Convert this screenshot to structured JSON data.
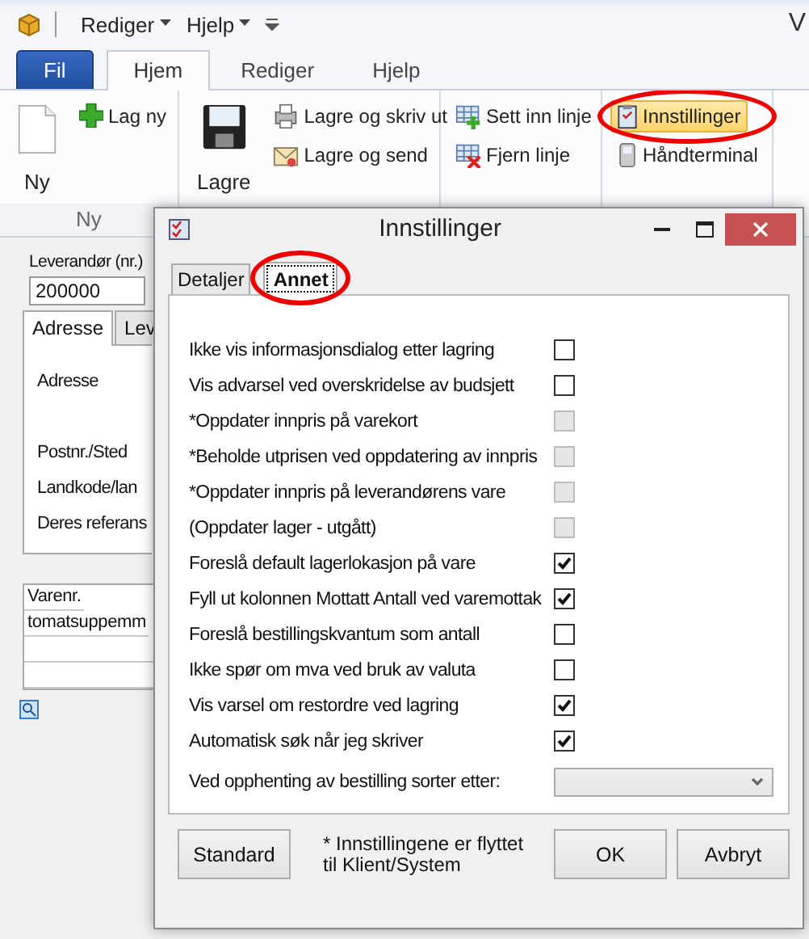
{
  "app": {
    "title_fragment": "V",
    "quick_menu": [
      {
        "label": "Rediger"
      },
      {
        "label": "Hjelp"
      }
    ]
  },
  "ribbon": {
    "tabs": [
      {
        "label": "Fil",
        "kind": "file",
        "selected": false
      },
      {
        "label": "Hjem",
        "kind": "tab",
        "selected": true
      },
      {
        "label": "Rediger",
        "kind": "tab",
        "selected": false
      },
      {
        "label": "Hjelp",
        "kind": "tab",
        "selected": false
      }
    ],
    "groups": [
      {
        "label": "Ny",
        "large": [
          {
            "label": "Ny"
          }
        ],
        "small": [
          {
            "label": "Lag ny",
            "active": false,
            "highlighted": false
          }
        ]
      },
      {
        "large": [
          {
            "label": "Lagre"
          }
        ],
        "small": [
          {
            "label": "Lagre og skriv ut",
            "active": false,
            "highlighted": false
          },
          {
            "label": "Lagre og send",
            "active": false,
            "highlighted": false
          }
        ]
      },
      {
        "small": [
          {
            "label": "Sett inn linje",
            "active": false,
            "highlighted": false
          },
          {
            "label": "Fjern linje",
            "active": false,
            "highlighted": false
          }
        ]
      },
      {
        "small": [
          {
            "label": "Innstillinger",
            "active": true,
            "highlighted": true
          },
          {
            "label": "Håndterminal",
            "active": false,
            "highlighted": false
          }
        ]
      }
    ]
  },
  "form": {
    "supplier_label": "Leverandør (nr.)",
    "supplier_value": "200000",
    "tabs": [
      {
        "label": "Adresse",
        "selected": true
      },
      {
        "label": "Lev",
        "selected": false
      }
    ],
    "fields": [
      {
        "label": "Adresse",
        "kind": "multiline"
      },
      {
        "label": "Postnr./Sted",
        "kind": "single"
      },
      {
        "label": "Landkode/lan",
        "kind": "single"
      },
      {
        "label": "Deres referans",
        "kind": "single"
      }
    ],
    "grid": {
      "columns": [
        "Varenr."
      ],
      "rows": [
        [
          "tomatsuppemm"
        ]
      ]
    }
  },
  "dialog": {
    "title": "Innstillinger",
    "tabs": [
      {
        "label": "Detaljer",
        "selected": false,
        "highlighted": false
      },
      {
        "label": "Annet",
        "selected": true,
        "highlighted": true
      }
    ],
    "options": [
      {
        "kind": "checkbox",
        "label": "Ikke vis informasjonsdialog etter lagring",
        "checked": false,
        "disabled": false
      },
      {
        "kind": "checkbox",
        "label": "Vis advarsel ved overskridelse av budsjett",
        "checked": false,
        "disabled": false
      },
      {
        "kind": "checkbox",
        "label": "*Oppdater innpris på varekort",
        "checked": false,
        "disabled": true
      },
      {
        "kind": "checkbox",
        "label": "*Beholde utprisen ved oppdatering av innpris",
        "checked": false,
        "disabled": true
      },
      {
        "kind": "checkbox",
        "label": "*Oppdater innpris på leverandørens vare",
        "checked": false,
        "disabled": true
      },
      {
        "kind": "checkbox",
        "label": "(Oppdater lager - utgått)",
        "checked": false,
        "disabled": true
      },
      {
        "kind": "checkbox",
        "label": "Foreslå default lagerlokasjon på vare",
        "checked": true,
        "disabled": false
      },
      {
        "kind": "checkbox",
        "label": "Fyll ut kolonnen Mottatt Antall ved varemottak",
        "checked": true,
        "disabled": false
      },
      {
        "kind": "checkbox",
        "label": "Foreslå bestillingskvantum som antall",
        "checked": false,
        "disabled": false
      },
      {
        "kind": "checkbox",
        "label": "Ikke spør om mva ved bruk av valuta",
        "checked": false,
        "disabled": false
      },
      {
        "kind": "checkbox",
        "label": "Vis varsel om restordre ved lagring",
        "checked": true,
        "disabled": false
      },
      {
        "kind": "checkbox",
        "label": "Automatisk søk når jeg skriver",
        "checked": true,
        "disabled": false
      },
      {
        "kind": "dropdown",
        "label": "Ved opphenting av bestilling sorter etter:"
      }
    ],
    "note_lines": [
      "* Innstillingene er flyttet",
      "til Klient/System"
    ],
    "buttons": [
      {
        "label": "Standard",
        "kind": "left"
      },
      {
        "label": "OK",
        "kind": "right"
      },
      {
        "label": "Avbryt",
        "kind": "right"
      }
    ]
  }
}
